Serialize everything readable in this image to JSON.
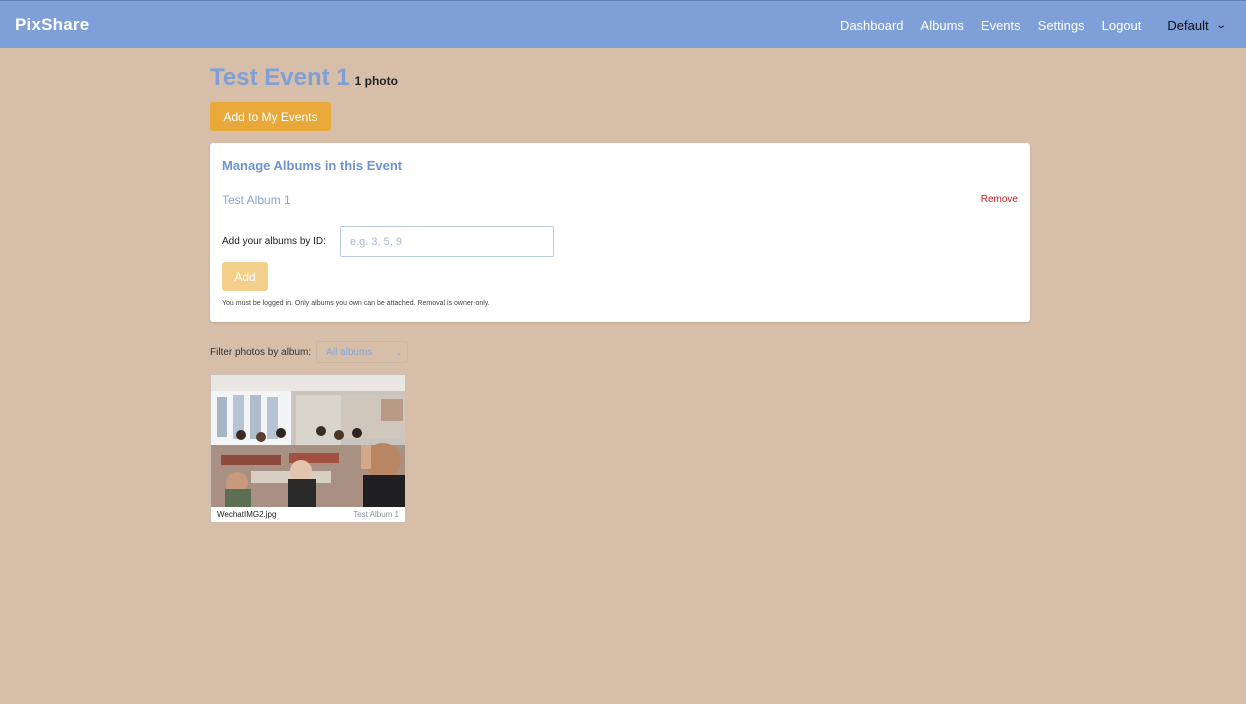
{
  "app": {
    "brand": "PixShare"
  },
  "nav": {
    "items": [
      {
        "label": "Dashboard"
      },
      {
        "label": "Albums"
      },
      {
        "label": "Events"
      },
      {
        "label": "Settings"
      },
      {
        "label": "Logout"
      }
    ],
    "profile": "Default"
  },
  "event": {
    "title": "Test Event 1",
    "photo_count": "1 photo",
    "add_button": "Add to My Events"
  },
  "manage": {
    "title": "Manage Albums in this Event",
    "albums": [
      {
        "name": "Test Album 1",
        "remove_label": "Remove"
      }
    ],
    "add_label": "Add your albums by ID:",
    "input_value": "",
    "input_placeholder": "e.g. 3, 5, 9",
    "add_button": "Add",
    "note": "You must be logged in. Only albums you own can be attached. Removal is owner-only."
  },
  "filter": {
    "label": "Filter photos by album:",
    "selected": "All albums"
  },
  "photos": [
    {
      "filename": "WechatIMG2.jpg",
      "album": "Test Album 1"
    }
  ],
  "icons": {
    "profile_chevron": "chevron-down-icon",
    "filter_chevron": "chevron-down-icon"
  }
}
